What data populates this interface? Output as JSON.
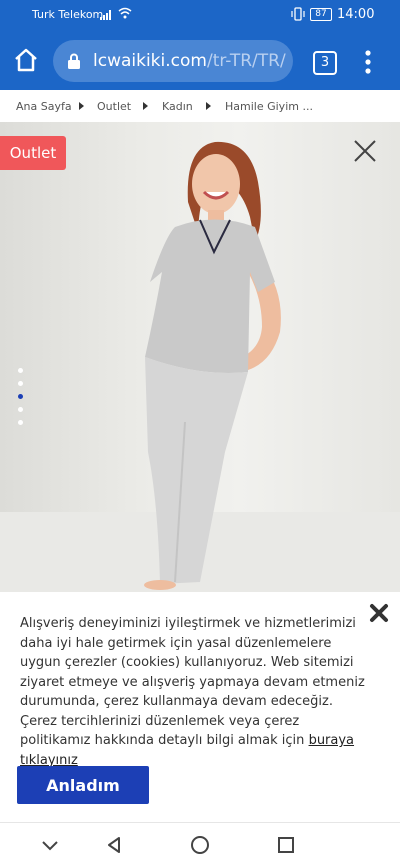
{
  "status_bar": {
    "carrier": "Turk Telekom",
    "battery": "87",
    "time": "14:00"
  },
  "browser": {
    "url_domain": "lcwaikiki.com",
    "url_path": "/tr-TR/TR/",
    "tab_count": "3"
  },
  "breadcrumb": {
    "items": [
      "Ana Sayfa",
      "Outlet",
      "Kadın",
      "Hamile Giyim ..."
    ]
  },
  "product": {
    "badge": "Outlet",
    "carousel_dots": 5,
    "active_dot": 3
  },
  "cookie": {
    "text": "Alışveriş deneyiminizi iyileştirmek ve hizmetlerimizi daha iyi hale getirmek için yasal düzenlemelere uygun çerezler (cookies) kullanıyoruz. Web sitemizi ziyaret etmeye ve alışveriş yapmaya devam etmeniz durumunda, çerez kullanmaya devam edeceğiz. Çerez tercihlerinizi düzenlemek veya çerez politikamız hakkında detaylı bilgi almak için",
    "link": "buraya tıklayınız",
    "accept_label": "Anladım"
  },
  "colors": {
    "browser_bar": "#1c66c7",
    "badge": "#f0575a",
    "primary_button": "#1c3fb5"
  }
}
